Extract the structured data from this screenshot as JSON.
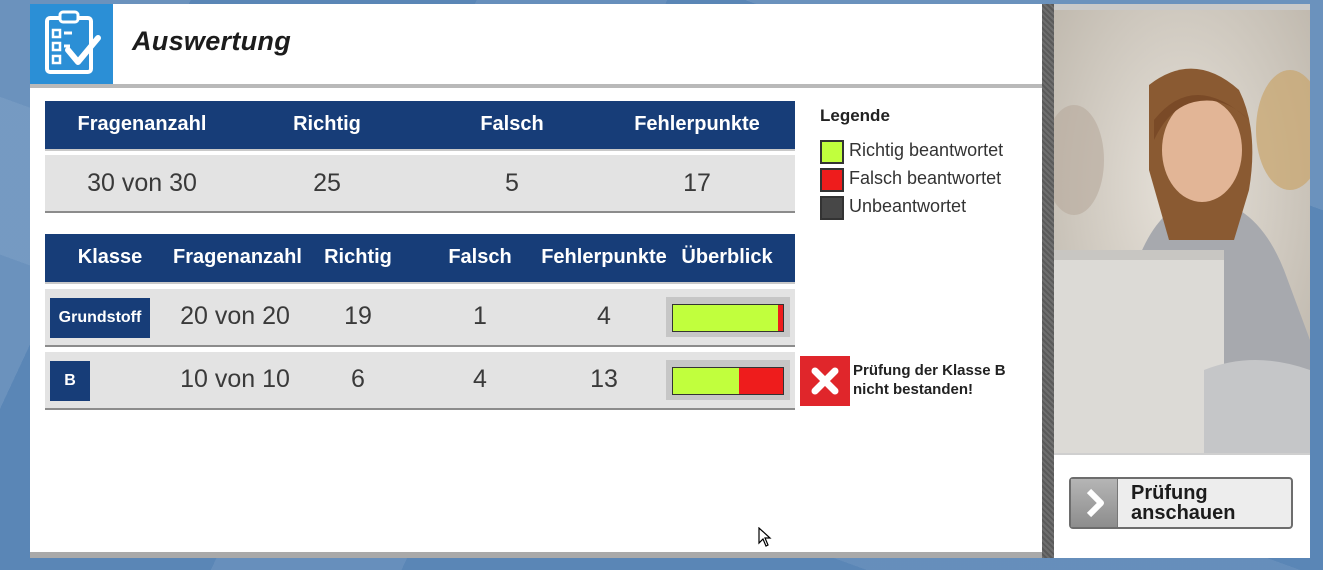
{
  "header": {
    "title": "Auswertung"
  },
  "summary": {
    "columns": [
      "Fragenanzahl",
      "Richtig",
      "Falsch",
      "Fehlerpunkte"
    ],
    "values": [
      "30 von 30",
      "25",
      "5",
      "17"
    ]
  },
  "classes": {
    "columns": [
      "Klasse",
      "Fragenanzahl",
      "Richtig",
      "Falsch",
      "Fehlerpunkte",
      "Überblick"
    ],
    "rows": [
      {
        "name": "Grundstoff",
        "questions": "20 von 20",
        "correct": "19",
        "wrong": "1",
        "points": "4",
        "correct_fraction": 0.95
      },
      {
        "name": "B",
        "questions": "10 von 10",
        "correct": "6",
        "wrong": "4",
        "points": "13",
        "correct_fraction": 0.6
      }
    ]
  },
  "legend": {
    "title": "Legende",
    "items": [
      {
        "label": "Richtig beantwortet",
        "color": "#c1ff3d"
      },
      {
        "label": "Falsch beantwortet",
        "color": "#ee1c1c"
      },
      {
        "label": "Unbeantwortet",
        "color": "#474747"
      }
    ]
  },
  "fail_notice": {
    "line1": "Prüfung der Klasse B",
    "line2": "nicht bestanden!"
  },
  "review_button": {
    "line1": "Prüfung",
    "line2": "anschauen"
  },
  "colors": {
    "accent": "#2b8fd6",
    "table_header": "#173d78",
    "fail": "#e0262b"
  }
}
